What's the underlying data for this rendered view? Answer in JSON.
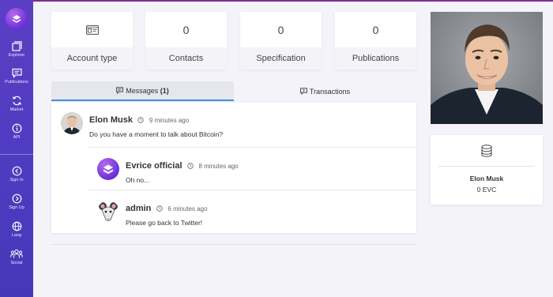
{
  "sidebar": {
    "items": [
      {
        "label": "Explorer",
        "icon": "explorer-icon"
      },
      {
        "label": "Publications",
        "icon": "publications-icon"
      },
      {
        "label": "Market",
        "icon": "market-icon"
      },
      {
        "label": "API",
        "icon": "api-icon"
      },
      {
        "label": "Sign In",
        "icon": "sign-in-icon"
      },
      {
        "label": "Sign Up",
        "icon": "sign-up-icon"
      },
      {
        "label": "Lang",
        "icon": "globe-icon"
      },
      {
        "label": "Social",
        "icon": "social-icon"
      }
    ],
    "accent": "#5a3fc4"
  },
  "stats": [
    {
      "value": "",
      "label": "Account type",
      "icon": "id-card-icon"
    },
    {
      "value": "0",
      "label": "Contacts"
    },
    {
      "value": "0",
      "label": "Specification"
    },
    {
      "value": "0",
      "label": "Publications"
    }
  ],
  "tabs": {
    "messages_label": "Messages",
    "messages_count": "(1)",
    "transactions_label": "Transactions"
  },
  "messages": [
    {
      "author": "Elon Musk",
      "time": "9 minutes ago",
      "text": "Do you have a moment to talk about Bitcoin?"
    },
    {
      "author": "Evrice official",
      "time": "8 minutes ago",
      "text": "Oh no..."
    },
    {
      "author": "admin",
      "time": "6 minutes ago",
      "text": "Please go back to Twitter!"
    }
  ],
  "profile": {
    "name": "Elon Musk",
    "balance": "0 EVC"
  }
}
